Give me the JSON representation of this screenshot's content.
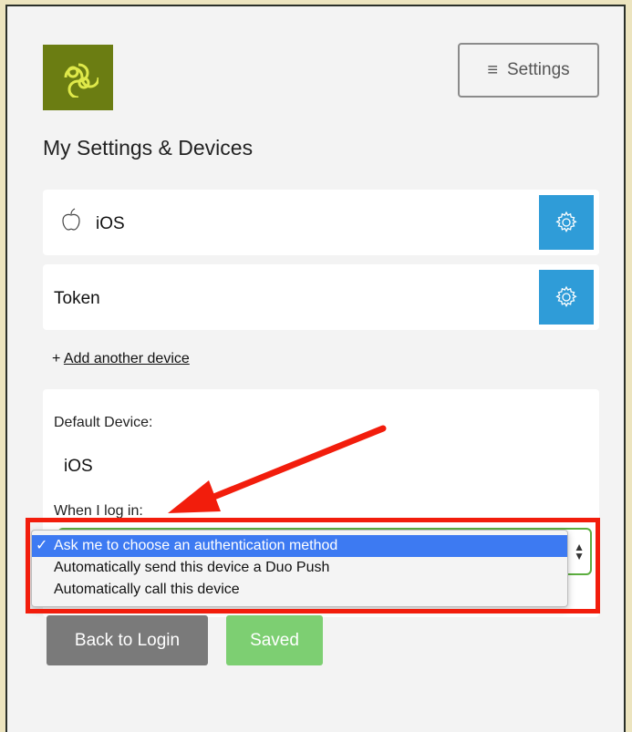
{
  "header": {
    "settings_label": "Settings"
  },
  "title": "My Settings & Devices",
  "devices": [
    {
      "label": "iOS"
    },
    {
      "label": "Token"
    }
  ],
  "add_device": {
    "prefix": "+",
    "link": "Add another device"
  },
  "default_device": {
    "label": "Default Device:",
    "value": "iOS",
    "login_label": "When I log in:"
  },
  "login_options": [
    "Ask me to choose an authentication method",
    "Automatically send this device a Duo Push",
    "Automatically call this device"
  ],
  "selected_option": "Ask me to choose an authentication method",
  "buttons": {
    "back": "Back to Login",
    "saved": "Saved"
  },
  "colors": {
    "brand_logo": "#6b7d12",
    "gear_button": "#2f9cd8",
    "highlight": "#f21d0c",
    "saved": "#7dcf72",
    "back": "#7a7a7a"
  },
  "icons": [
    "logo-mark",
    "menu-icon",
    "apple-icon",
    "gear-icon",
    "check-icon",
    "select-arrows-icon"
  ]
}
